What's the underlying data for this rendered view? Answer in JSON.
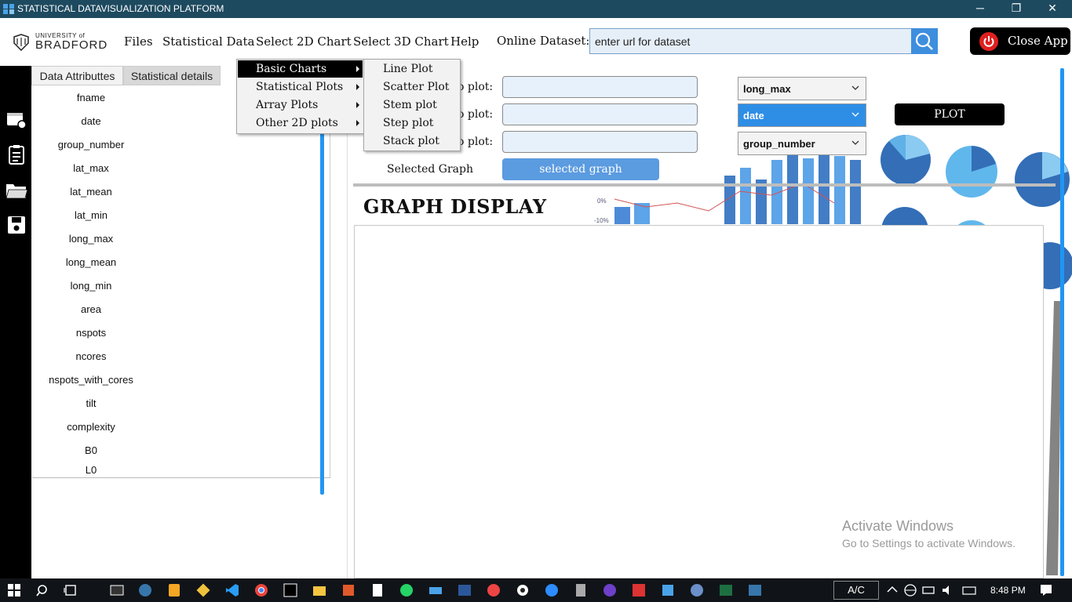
{
  "window": {
    "title": "STATISTICAL DATAVISUALIZATION PLATFORM",
    "minimize": "─",
    "restore": "❐",
    "close": "✕"
  },
  "logo": {
    "top": "UNIVERSITY of",
    "name": "BRADFORD"
  },
  "menubar": {
    "items": [
      "Files",
      "Statistical Data",
      "Select 2D Chart",
      "Select 3D Chart",
      "Help"
    ],
    "online_label": "Online Dataset:",
    "url_placeholder": "enter url for dataset",
    "close_label": "Close App"
  },
  "tabs": [
    "Data Attributtes",
    "Statistical details"
  ],
  "attributes": [
    "fname",
    "date",
    "group_number",
    "lat_max",
    "lat_mean",
    "lat_min",
    "long_max",
    "long_mean",
    "long_min",
    "area",
    "nspots",
    "ncores",
    "nspots_with_cores",
    "tilt",
    "complexity",
    "B0",
    "L0"
  ],
  "plot_form": {
    "labels": [
      "o plot:",
      "o plot:",
      "o plot:"
    ],
    "selects": [
      "long_max",
      "date",
      "group_number"
    ],
    "plot_button": "PLOT",
    "selected_graph_label": "Selected Graph",
    "selected_graph_button": "selected graph"
  },
  "graph_display_title": "GRAPH DISPLAY",
  "menu_2d": {
    "items": [
      "Basic Charts",
      "Statistical Plots",
      "Array Plots",
      "Other 2D plots"
    ],
    "highlighted": "Basic Charts"
  },
  "submenu_basic": {
    "items": [
      "Line Plot",
      "Scatter Plot",
      "Stem plot",
      "Step plot",
      "Stack plot"
    ]
  },
  "watermark": {
    "line1": "Activate Windows",
    "line2": "Go to Settings to activate Windows."
  },
  "taskbar": {
    "ac": "A/C",
    "time": "8:48 PM"
  },
  "colors": {
    "accent": "#2196f3",
    "titlebar": "#1e4a5f",
    "highlight_select": "#2e8ee6"
  }
}
